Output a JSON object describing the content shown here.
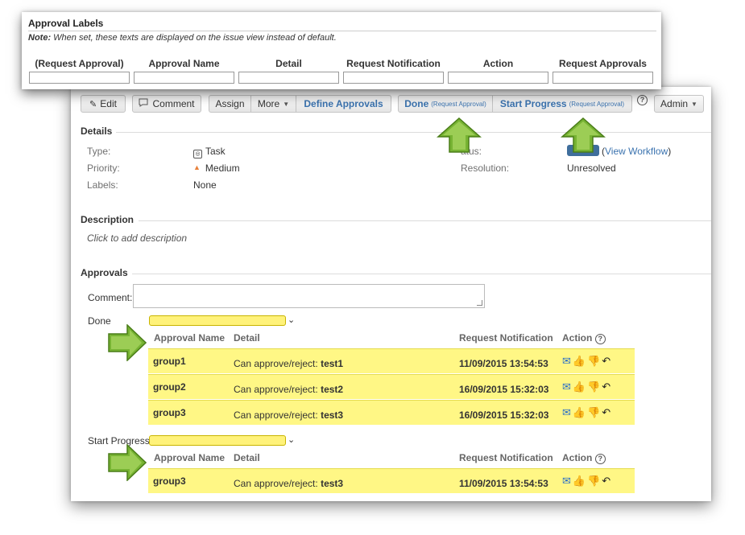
{
  "toolbar": {
    "edit": "Edit",
    "comment": "Comment",
    "assign": "Assign",
    "more": "More",
    "define_approvals": "Define Approvals",
    "done": "Done",
    "done_hint": "(Request Approval)",
    "start_progress": "Start Progress",
    "start_progress_hint": "(Request Approval)",
    "admin": "Admin"
  },
  "details": {
    "title": "Details",
    "type_label": "Type:",
    "type_value": "Task",
    "priority_label": "Priority:",
    "priority_value": "Medium",
    "labels_label": "Labels:",
    "labels_value": "None",
    "status_label": "atus:",
    "view_workflow": "View Workflow",
    "resolution_label": "Resolution:",
    "resolution_value": "Unresolved"
  },
  "description": {
    "title": "Description",
    "placeholder": "Click to add description"
  },
  "approvals": {
    "title": "Approvals",
    "comment_label": "Comment:",
    "columns": {
      "name": "Approval Name",
      "detail": "Detail",
      "notification": "Request Notification",
      "action": "Action"
    },
    "detail_prefix": "Can approve/reject:",
    "transitions": [
      {
        "label": "Done",
        "rows": [
          {
            "name": "group1",
            "user": "test1",
            "date": "11/09/2015 13:54:53"
          },
          {
            "name": "group2",
            "user": "test2",
            "date": "16/09/2015 15:32:03"
          },
          {
            "name": "group3",
            "user": "test3",
            "date": "16/09/2015 15:32:03"
          }
        ]
      },
      {
        "label": "Start Progress",
        "rows": [
          {
            "name": "group3",
            "user": "test3",
            "date": "11/09/2015 13:54:53"
          }
        ]
      }
    ]
  },
  "approval_labels": {
    "title": "Approval Labels",
    "note_bold": "Note:",
    "note_text": "When set, these texts are displayed on the issue view instead of default.",
    "columns": [
      "(Request Approval)",
      "Approval Name",
      "Detail",
      "Request Notification",
      "Action",
      "Request Approvals"
    ]
  },
  "colors": {
    "highlight": "#fff785",
    "link": "#3b73af",
    "arrow": "#6aa82c"
  },
  "icons": {
    "edit": "pencil-icon",
    "comment": "speech-bubble-icon",
    "type": "task-icon",
    "priority": "priority-medium-icon",
    "help": "question-circle-icon",
    "actions": [
      "email-icon",
      "thumbs-up-icon",
      "thumbs-down-icon",
      "undo-icon"
    ]
  }
}
